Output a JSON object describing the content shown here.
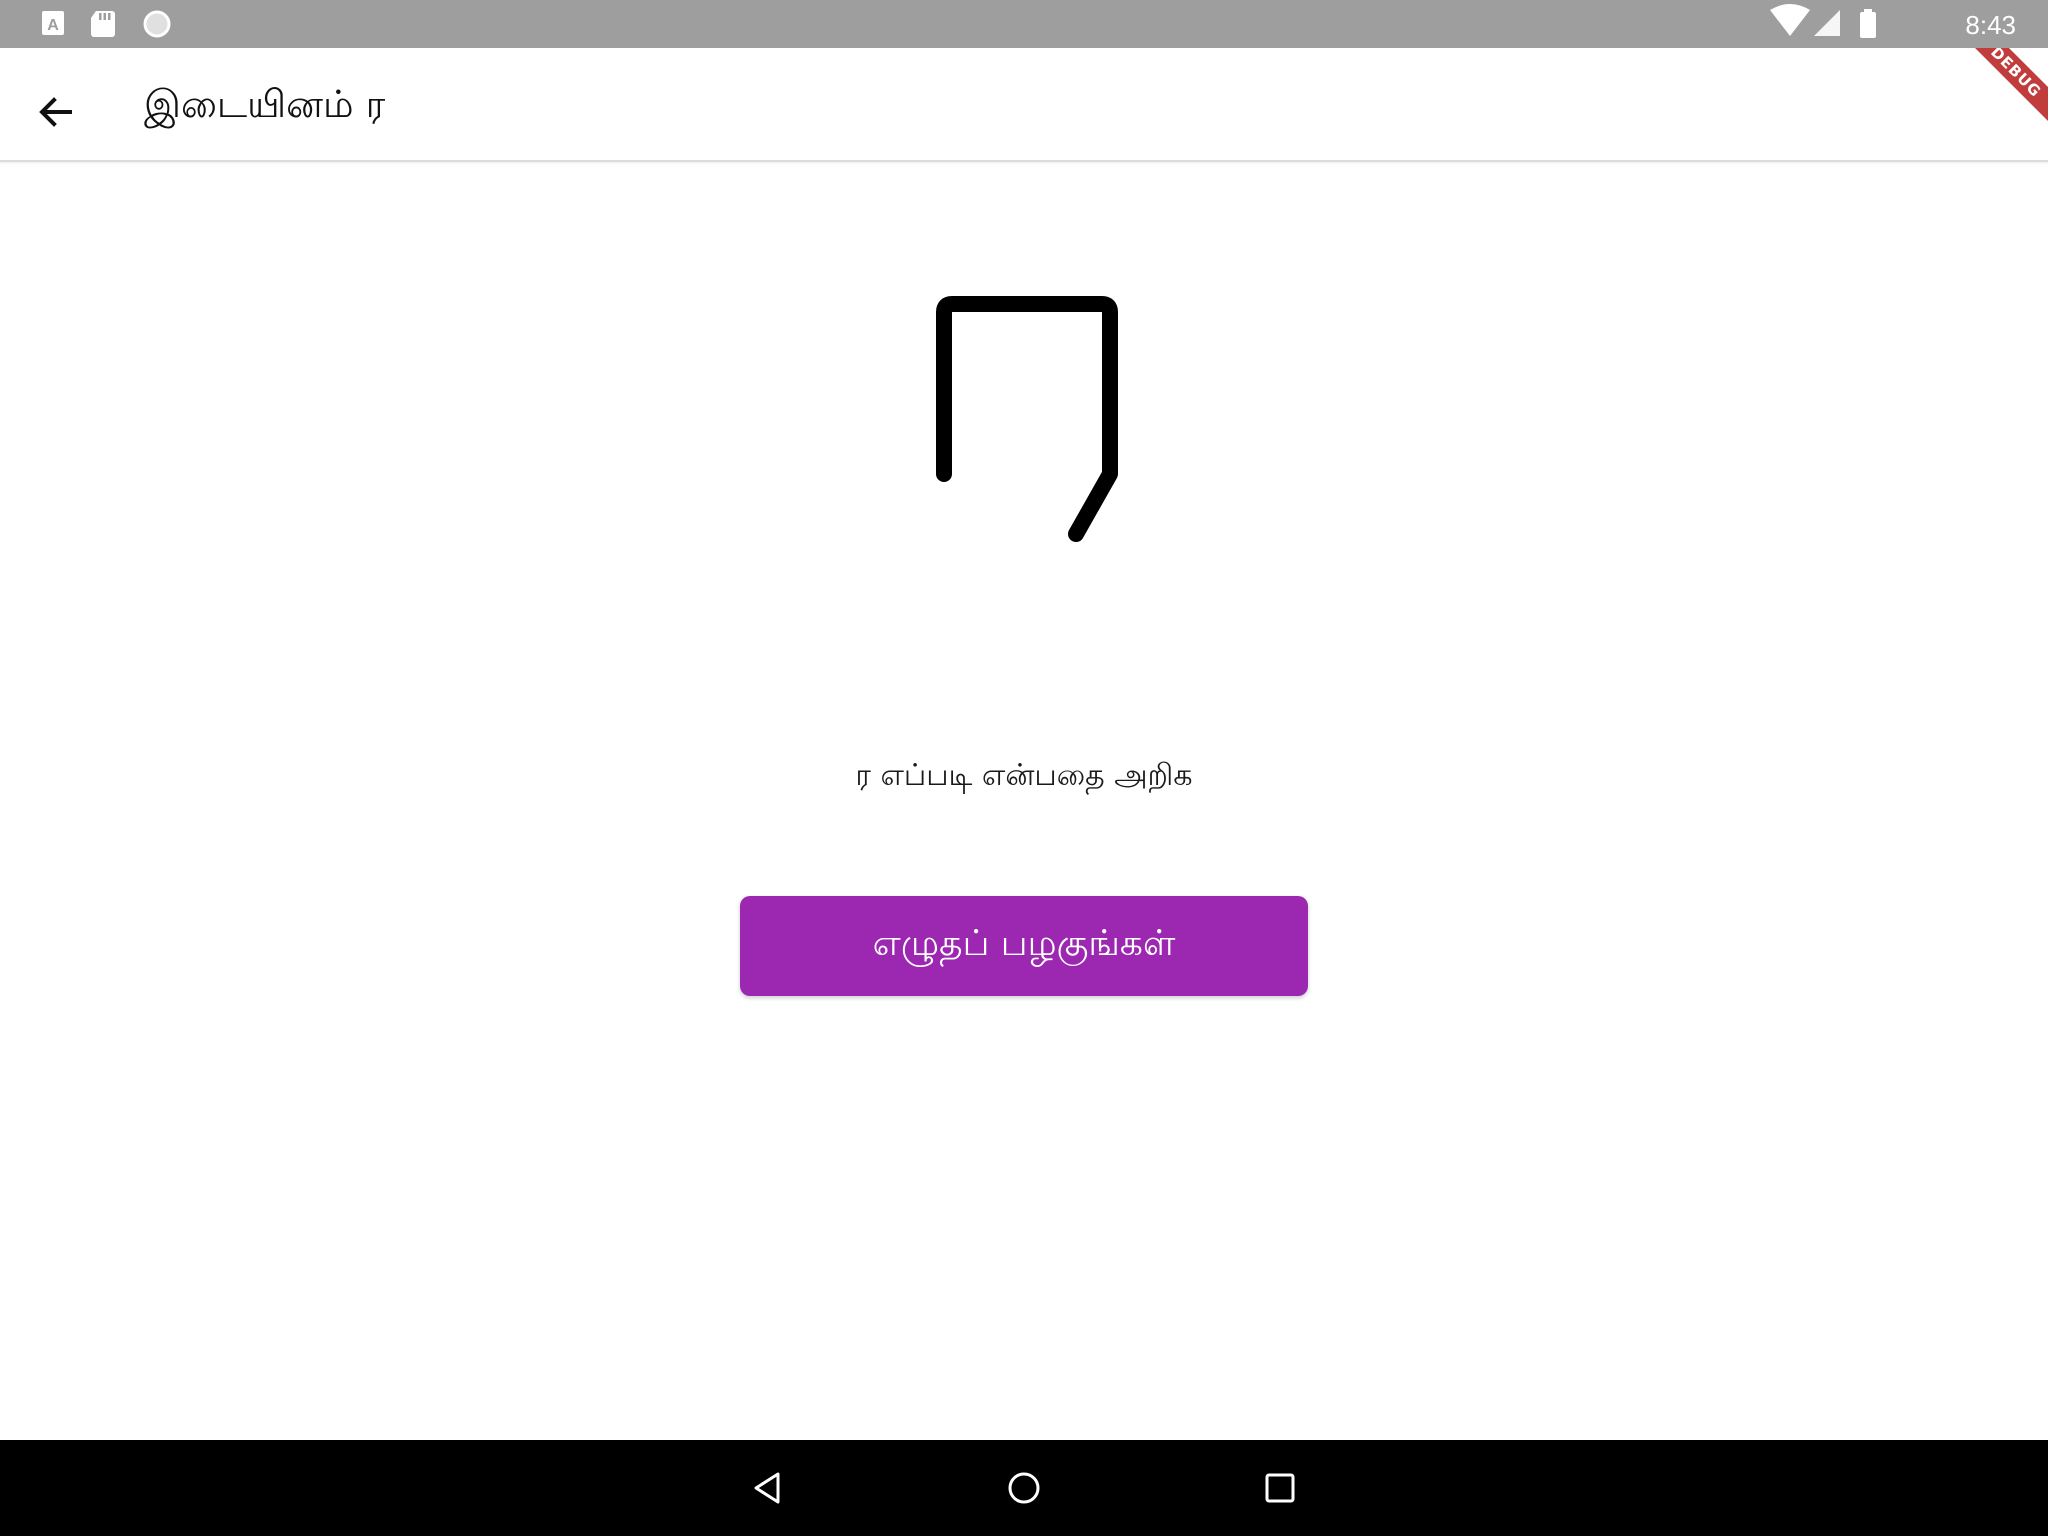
{
  "status_bar": {
    "time": "8:43",
    "left_icons": [
      "accessibility-font-icon",
      "sd-card-icon",
      "circle-icon"
    ],
    "right_icons": [
      "wifi-icon",
      "signal-icon",
      "battery-icon"
    ]
  },
  "app_bar": {
    "back_icon": "arrow-left-icon",
    "title": "இடையினம் ர"
  },
  "debug_banner": {
    "label": "DEBUG"
  },
  "main": {
    "letter_glyph": "ர",
    "instruction": "ர எப்படி என்பதை அறிக",
    "practice_button_label": "எழுதப் பழகுங்கள்"
  },
  "colors": {
    "status_bar": "#9e9e9e",
    "accent_button": "#9c27b0",
    "nav_bar": "#000000",
    "debug_ribbon": "#b71c1c"
  },
  "nav_bar": {
    "icons": [
      "back-triangle-icon",
      "home-circle-icon",
      "recents-square-icon"
    ]
  }
}
